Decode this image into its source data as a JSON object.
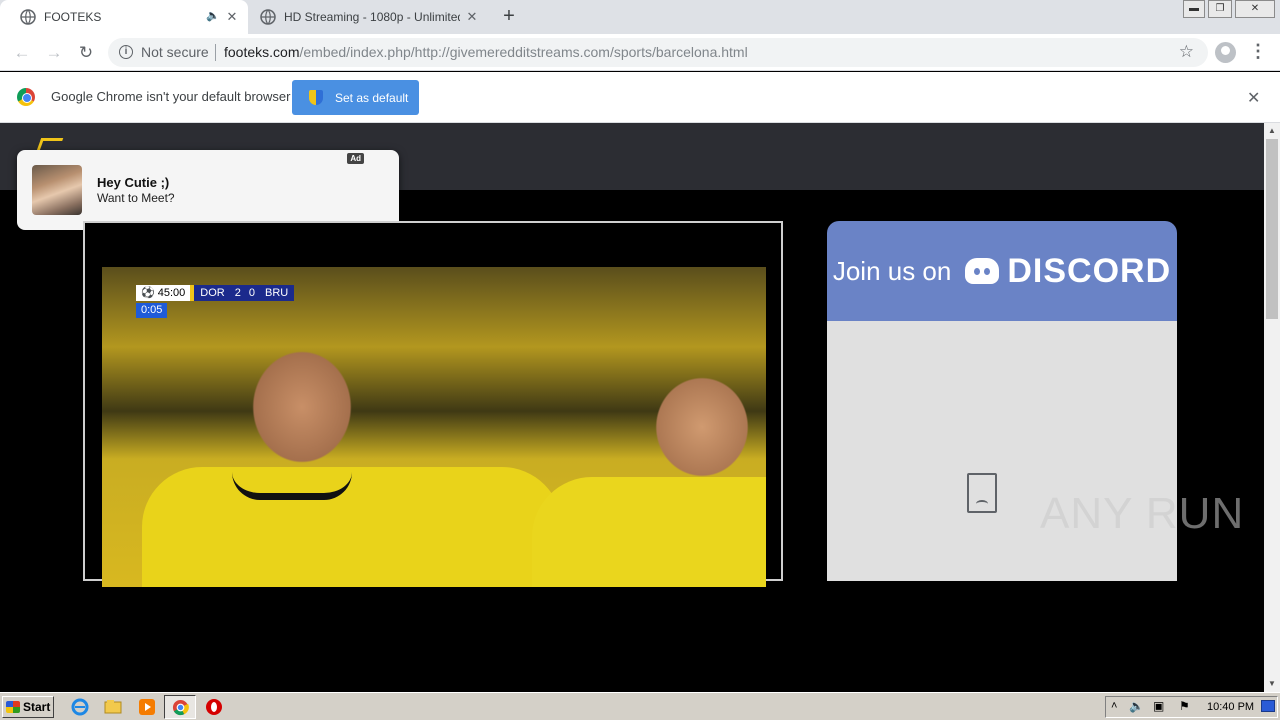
{
  "browser": {
    "tabs": [
      {
        "title": "FOOTEKS",
        "active": true,
        "audio": true
      },
      {
        "title": "HD Streaming - 1080p - Unlimited Do",
        "active": false,
        "audio": false
      }
    ],
    "new_tab_label": "+",
    "address": {
      "security_label": "Not secure",
      "host": "footeks.com",
      "path": "/embed/index.php/http://givemeredditstreams.com/sports/barcelona.html"
    }
  },
  "infobar": {
    "message": "Google Chrome isn't your default browser",
    "button_label": "Set as default"
  },
  "popup_ad": {
    "tag": "Ad",
    "heading": "Hey Cutie ;)",
    "body": "Want to Meet?"
  },
  "video": {
    "clock": "45:00",
    "home_team": "DOR",
    "home_score": "2",
    "away_score": "0",
    "away_team": "BRU",
    "added_time": "0:05"
  },
  "discord_banner": {
    "join_label": "Join us on",
    "brand": "DISCORD"
  },
  "watermark": "ANY RUN",
  "taskbar": {
    "start_label": "Start",
    "clock": "10:40 PM"
  }
}
